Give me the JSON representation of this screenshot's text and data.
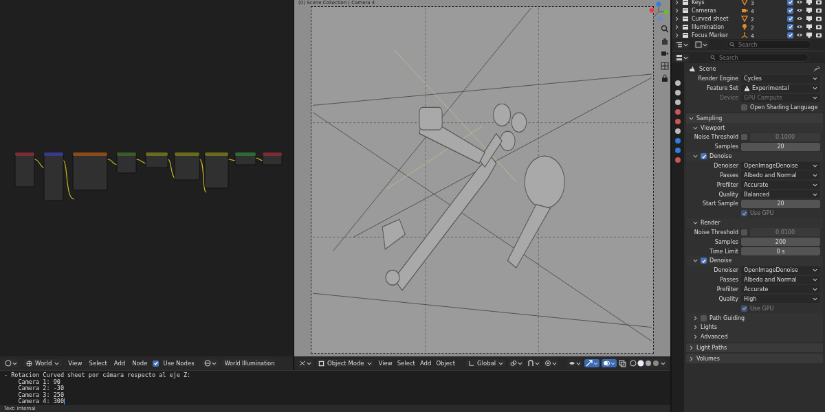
{
  "outliner": {
    "rows": [
      {
        "name": "Keys",
        "kind": "mesh",
        "badge": "3",
        "checked": true
      },
      {
        "name": "Cameras",
        "kind": "camera",
        "badge": "4",
        "checked": true
      },
      {
        "name": "Curved sheet",
        "kind": "mesh",
        "badge": "2",
        "checked": true
      },
      {
        "name": "Illumination",
        "kind": "light",
        "badge": "2",
        "checked": true
      },
      {
        "name": "Focus Marker",
        "kind": "empty",
        "badge": "4",
        "checked": true
      }
    ],
    "search": {
      "placeholder": "Search"
    }
  },
  "viewport": {
    "overlay_text": "(0) Scene Collection | Camera 4",
    "header": {
      "mode": "Object Mode",
      "menus": [
        "View",
        "Select",
        "Add",
        "Object"
      ],
      "orientation": "Global"
    }
  },
  "node_editor": {
    "header": {
      "world_type": "World",
      "menus": [
        "View",
        "Select",
        "Add",
        "Node"
      ],
      "use_nodes": {
        "label": "Use Nodes",
        "checked": true
      },
      "world_name": "World Illumination"
    }
  },
  "text_editor": {
    "lines": [
      "- Rotacion Curved sheet por cámara respecto al eje Z:",
      "    Camera 1: 90",
      "    Camera 2: -30",
      "    Camera 3: 250",
      "    Camera 4: 300"
    ]
  },
  "status_bar": {
    "text": "Text: Internal"
  },
  "properties": {
    "search": {
      "placeholder": "Search"
    },
    "context": "Scene",
    "items": [
      {
        "kind": "select",
        "label": "Render Engine",
        "value": "Cycles",
        "disabled": false,
        "warning": false
      },
      {
        "kind": "select",
        "label": "Feature Set",
        "value": "Experimental",
        "disabled": false,
        "warning": true
      },
      {
        "kind": "select",
        "label": "Device",
        "value": "GPU Compute",
        "disabled": true,
        "warning": false
      },
      {
        "kind": "check",
        "label": "Open Shading Language",
        "checked": false,
        "disabled": false
      },
      {
        "kind": "panel",
        "label": "Sampling",
        "expanded": true
      },
      {
        "kind": "subpanel",
        "label": "Viewport",
        "expanded": true
      },
      {
        "kind": "threshold",
        "label": "Noise Threshold",
        "checked": false,
        "value": "0.1000"
      },
      {
        "kind": "number",
        "label": "Samples",
        "value": "20"
      },
      {
        "kind": "subcheck",
        "label": "Denoise",
        "checked": true,
        "expanded": true
      },
      {
        "kind": "select",
        "label": "Denoiser",
        "value": "OpenImageDenoise",
        "disabled": false,
        "warning": false
      },
      {
        "kind": "select",
        "label": "Passes",
        "value": "Albedo and Normal",
        "disabled": false,
        "warning": false
      },
      {
        "kind": "select",
        "label": "Prefilter",
        "value": "Accurate",
        "disabled": false,
        "warning": false
      },
      {
        "kind": "select",
        "label": "Quality",
        "value": "Balanced",
        "disabled": false,
        "warning": false
      },
      {
        "kind": "number",
        "label": "Start Sample",
        "value": "20"
      },
      {
        "kind": "check",
        "label": "Use GPU",
        "checked": true,
        "disabled": true
      },
      {
        "kind": "subpanel",
        "label": "Render",
        "expanded": true
      },
      {
        "kind": "threshold",
        "label": "Noise Threshold",
        "checked": false,
        "value": "0.0100"
      },
      {
        "kind": "number",
        "label": "Samples",
        "value": "200"
      },
      {
        "kind": "number",
        "label": "Time Limit",
        "value": "0 s"
      },
      {
        "kind": "subcheck",
        "label": "Denoise",
        "checked": true,
        "expanded": true
      },
      {
        "kind": "select",
        "label": "Denoiser",
        "value": "OpenImageDenoise",
        "disabled": false,
        "warning": false
      },
      {
        "kind": "select",
        "label": "Passes",
        "value": "Albedo and Normal",
        "disabled": false,
        "warning": false
      },
      {
        "kind": "select",
        "label": "Prefilter",
        "value": "Accurate",
        "disabled": false,
        "warning": false
      },
      {
        "kind": "select",
        "label": "Quality",
        "value": "High",
        "disabled": false,
        "warning": false
      },
      {
        "kind": "check",
        "label": "Use GPU",
        "checked": true,
        "disabled": true
      },
      {
        "kind": "subcheck",
        "label": "Path Guiding",
        "checked": false,
        "expanded": false
      },
      {
        "kind": "subpanel",
        "label": "Lights",
        "expanded": false
      },
      {
        "kind": "subpanel",
        "label": "Advanced",
        "expanded": false
      },
      {
        "kind": "panel",
        "label": "Light Paths",
        "expanded": false
      },
      {
        "kind": "panel",
        "label": "Volumes",
        "expanded": false
      }
    ]
  }
}
